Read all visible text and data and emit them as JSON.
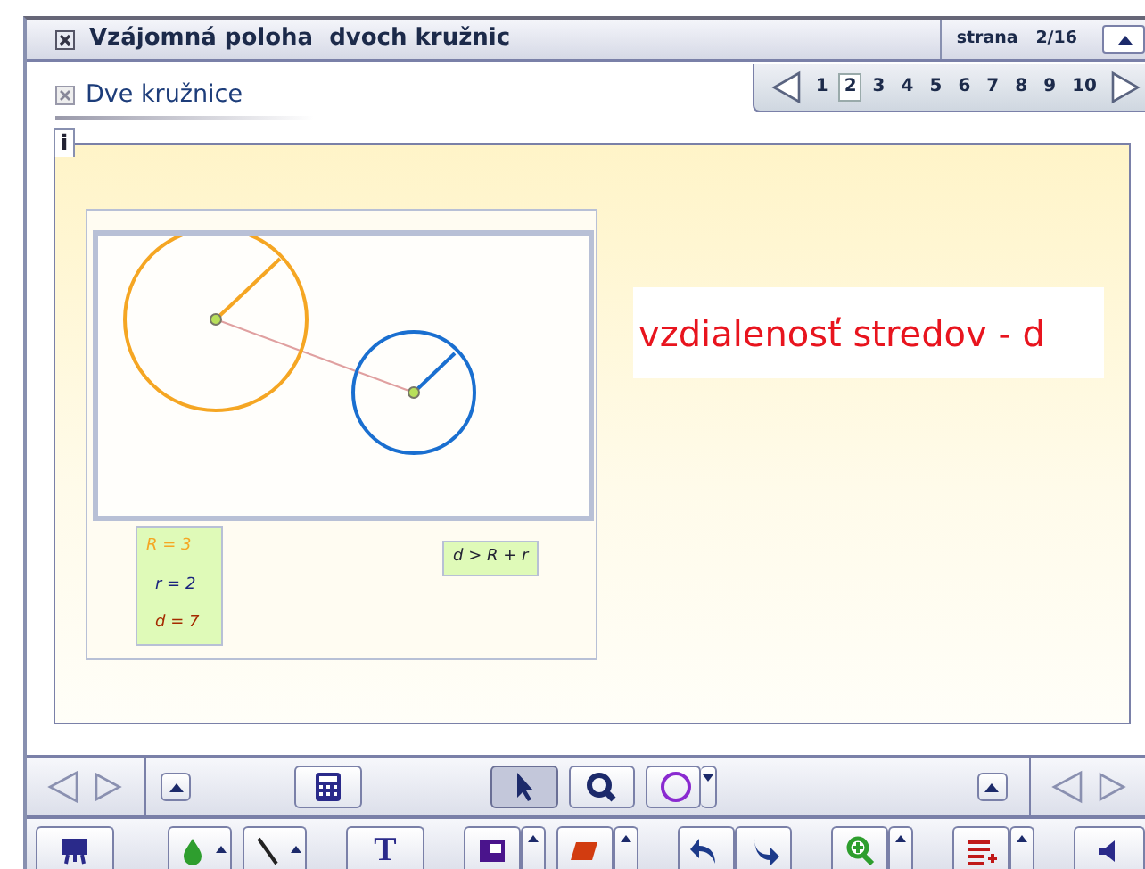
{
  "window": {
    "title": "Vzájomná poloha  dvoch kružnic",
    "page_indicator": "strana   2/16"
  },
  "pager": {
    "pages": [
      {
        "label": "1",
        "selected": false
      },
      {
        "label": "2",
        "selected": true
      },
      {
        "label": "3",
        "selected": false
      },
      {
        "label": "4",
        "selected": false
      },
      {
        "label": "5",
        "selected": false
      },
      {
        "label": "6",
        "selected": false
      },
      {
        "label": "7",
        "selected": false
      },
      {
        "label": "8",
        "selected": false
      },
      {
        "label": "9",
        "selected": false
      },
      {
        "label": "10",
        "selected": false
      }
    ]
  },
  "section": {
    "title": "Dve kružnice",
    "info": "i"
  },
  "slide": {
    "heading": "vzdialenosť stredov - d",
    "values": [
      {
        "text": "R = 3",
        "color": "#f5a623"
      },
      {
        "text": "r = 2",
        "color": "#1a237e"
      },
      {
        "text": "d = 7",
        "color": "#a52a00"
      }
    ],
    "relation": "d > R + r"
  },
  "toolbar": {
    "text_tool_label": "T",
    "tools": [
      {
        "kind": "calculator",
        "selected": false
      },
      {
        "kind": "pointer",
        "selected": true
      },
      {
        "kind": "zoom",
        "selected": false
      },
      {
        "kind": "circle",
        "selected": false
      }
    ]
  }
}
